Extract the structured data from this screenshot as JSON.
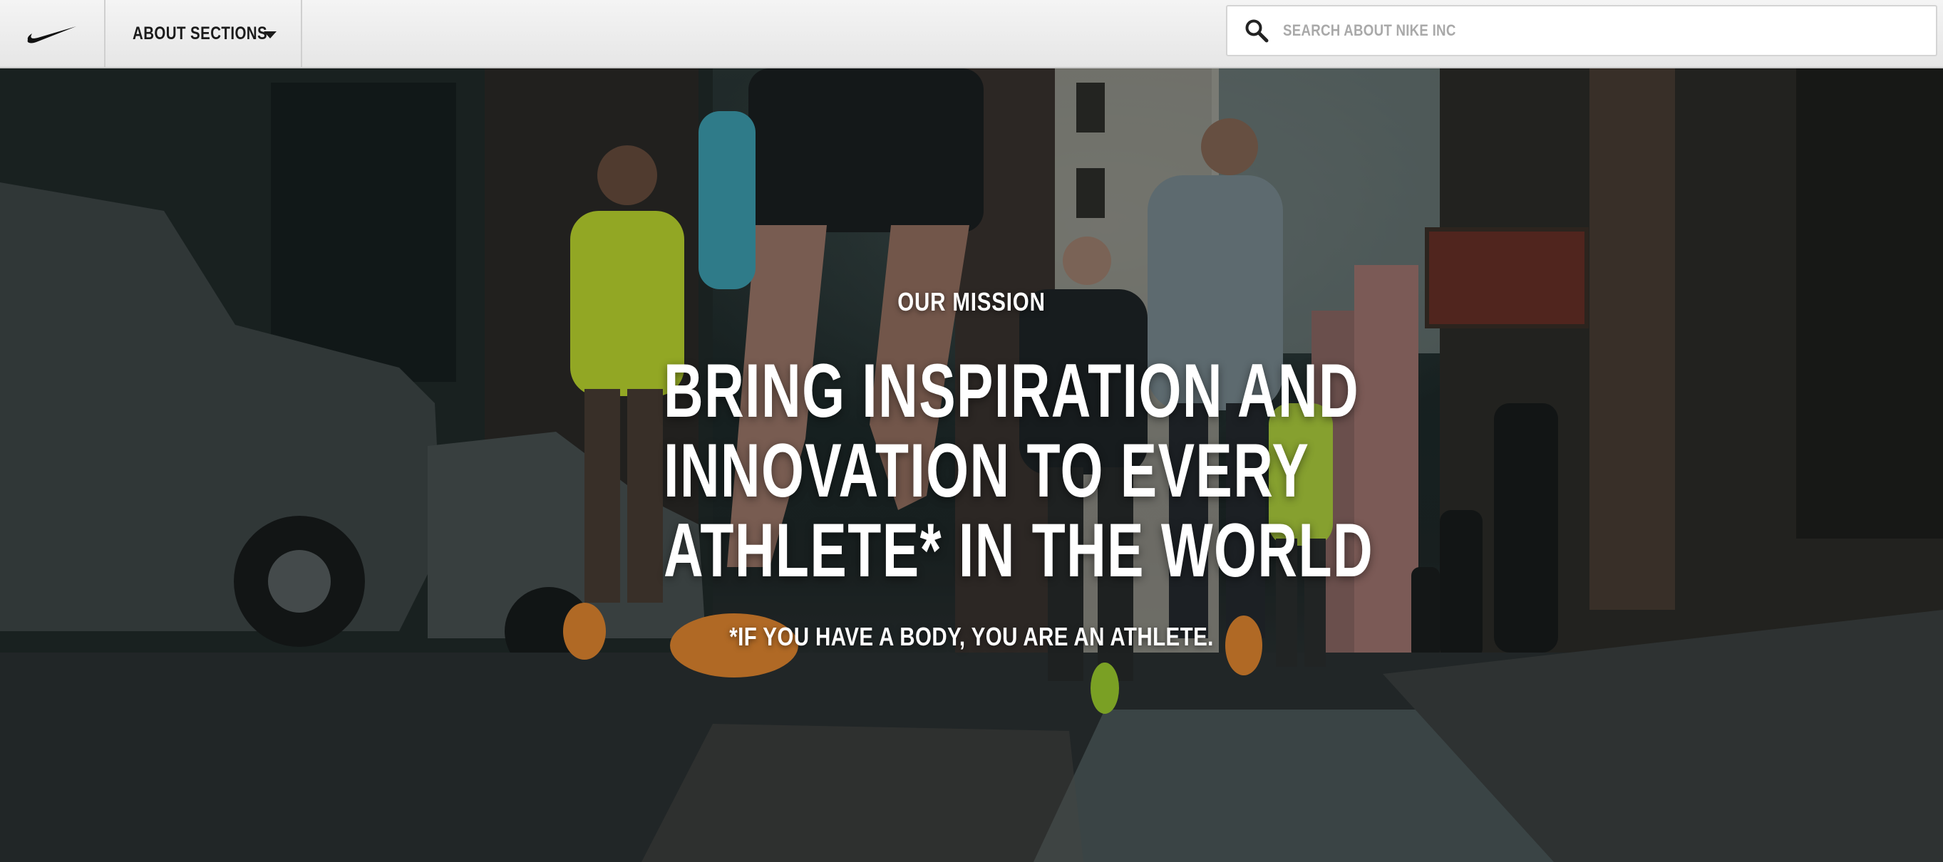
{
  "header": {
    "logo_icon": "nike-swoosh-icon",
    "sections_label": "ABOUT SECTIONS",
    "sections_icon": "caret-down-icon",
    "search": {
      "icon": "search-icon",
      "placeholder": "SEARCH ABOUT NIKE INC",
      "value": ""
    }
  },
  "hero": {
    "eyebrow": "OUR MISSION",
    "headline_lines": [
      "BRING INSPIRATION AND",
      "INNOVATION TO EVERY",
      "ATHLETE* IN THE WORLD"
    ],
    "tagline": "*IF YOU HAVE A BODY, YOU ARE AN ATHLETE.",
    "background_description_icon": "runners-photo"
  },
  "colors": {
    "topbar_bg": "#ececec",
    "text_dark": "#1b1b1b",
    "placeholder": "#a9a9a9",
    "hero_text": "#ffffff",
    "accent_vest": "#c6e02a",
    "shoe_orange": "#f08a2c"
  }
}
